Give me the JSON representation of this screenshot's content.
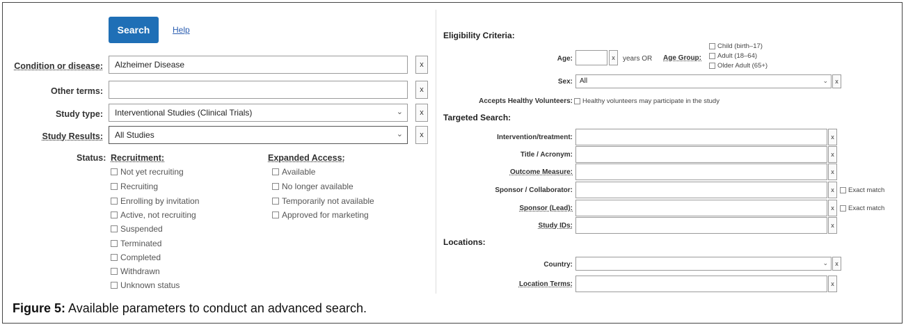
{
  "left": {
    "search_button": "Search",
    "help_link": "Help",
    "condition": {
      "label": "Condition or disease:",
      "value": "Alzheimer Disease"
    },
    "other_terms": {
      "label": "Other terms:",
      "value": ""
    },
    "study_type": {
      "label": "Study type:",
      "value": "Interventional Studies (Clinical Trials)"
    },
    "study_results": {
      "label": "Study Results:",
      "value": "All Studies"
    },
    "status_label": "Status:",
    "recruitment": {
      "heading": "Recruitment:",
      "options": [
        "Not yet recruiting",
        "Recruiting",
        "Enrolling by invitation",
        "Active, not recruiting",
        "Suspended",
        "Terminated",
        "Completed",
        "Withdrawn",
        "Unknown status"
      ]
    },
    "expanded_access": {
      "heading": "Expanded Access:",
      "options": [
        "Available",
        "No longer available",
        "Temporarily not available",
        "Approved for marketing"
      ]
    },
    "clear": "x"
  },
  "right": {
    "eligibility_heading": "Eligibility Criteria:",
    "age_label": "Age:",
    "age_value": "",
    "years_or": "years  OR",
    "age_group_label": "Age Group:",
    "age_groups": [
      "Child (birth–17)",
      "Adult (18–64)",
      "Older Adult (65+)"
    ],
    "sex_label": "Sex:",
    "sex_value": "All",
    "healthy_label": "Accepts Healthy Volunteers:",
    "healthy_option": "Healthy volunteers may participate in the study",
    "targeted_heading": "Targeted Search:",
    "targeted_fields": [
      "Intervention/treatment:",
      "Title / Acronym:",
      "Outcome Measure:",
      "Sponsor / Collaborator:",
      "Sponsor (Lead):",
      "Study IDs:"
    ],
    "exact_match": "Exact match",
    "locations_heading": "Locations:",
    "country_label": "Country:",
    "country_value": "",
    "location_terms_label": "Location Terms:",
    "clear": "x"
  },
  "caption": {
    "label": "Figure 5:",
    "text": " Available parameters to conduct an advanced search."
  }
}
